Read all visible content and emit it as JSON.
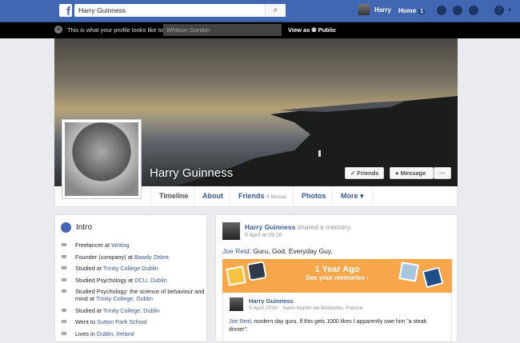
{
  "topbar": {
    "search_value": "Harry Guinness",
    "user": "Harry",
    "home": "Home",
    "home_badge": "1"
  },
  "viewbar": {
    "message": "This is what your profile looks like to:",
    "viewer": "Whitson Gordon",
    "view_as": "View as",
    "audience": "Public"
  },
  "profile": {
    "name": "Harry Guinness",
    "friends_button": "✓ Friends",
    "message_button": "Message",
    "more_button": "···"
  },
  "tabs": [
    {
      "label": "Timeline"
    },
    {
      "label": "About"
    },
    {
      "label": "Friends",
      "sub": "4 Mutual"
    },
    {
      "label": "Photos"
    },
    {
      "label": "More ▾"
    }
  ],
  "intro": {
    "title": "Intro",
    "items": [
      {
        "pre": "Freelancer at ",
        "link": "Writing"
      },
      {
        "pre": "Founder (company) at ",
        "link": "Bawdy Zebra"
      },
      {
        "pre": "Studied at ",
        "link": "Trinity College Dublin"
      },
      {
        "pre": "Studied Psychology at ",
        "link": "DCU, Dublin"
      },
      {
        "pre": "Studied Psychology: the science of behaviour and mind at ",
        "link": "Trinity College, Dublin"
      },
      {
        "pre": "Studied at ",
        "link": "Trinity College, Dublin"
      },
      {
        "pre": "Went to ",
        "link": "Sutton Park School"
      },
      {
        "pre": "Lives in ",
        "link": "Dublin, Ireland"
      }
    ]
  },
  "post": {
    "author": "Harry Guinness",
    "action": "shared a memory.",
    "time": "6 April at 09:16",
    "mention": "Joe Reid",
    "text": ": Guru, God, Everyday Guy.",
    "memory": {
      "title": "1 Year Ago",
      "link": "See your memories  ›"
    },
    "shared": {
      "author": "Harry Guinness",
      "meta": "5 April 2016 · Saint-Martin-de-Belleville, France",
      "mention": "Joe Reid",
      "text": ", modern day guru. If this gets 1000 likes I apparently owe him \"a steak dinner\"."
    }
  }
}
